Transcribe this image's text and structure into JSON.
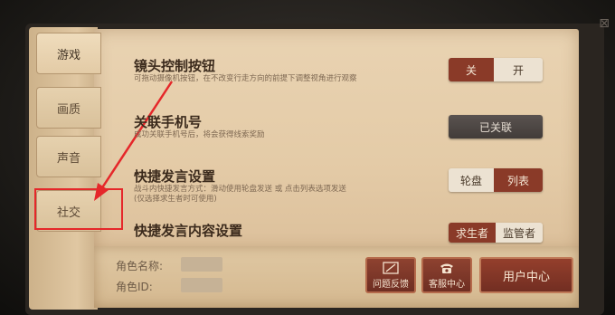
{
  "tabs": [
    {
      "label": "游戏",
      "active": true
    },
    {
      "label": "画质"
    },
    {
      "label": "声音"
    },
    {
      "label": "社交",
      "highlighted": true
    }
  ],
  "settings": {
    "camera": {
      "title": "镜头控制按钮",
      "desc": "可拖动摄像机按钮，在不改变行走方向的前提下调整视角进行观察",
      "toggle": {
        "off_label": "关",
        "on_label": "开",
        "selected": "关"
      }
    },
    "phone": {
      "title": "关联手机号",
      "desc": "成功关联手机号后，将会获得线索奖励",
      "button_label": "已关联"
    },
    "quick_chat": {
      "title": "快捷发言设置",
      "desc_line1": "战斗内快捷发言方式：滑动使用轮盘发送 或 点击列表选项发送",
      "desc_line2": "(仅选择求生者时可使用)",
      "toggle": {
        "a": "轮盘",
        "b": "列表",
        "selected": "列表"
      }
    },
    "quick_chat_content": {
      "title": "快捷发言内容设置",
      "toggle": {
        "a": "求生者",
        "b": "监管者",
        "selected": "求生者"
      }
    }
  },
  "info": {
    "role_name_label": "角色名称:",
    "role_id_label": "角色ID:"
  },
  "actions": {
    "feedback": "问题反馈",
    "support": "客服中心",
    "user_center": "用户中心"
  },
  "colors": {
    "accent_red": "#8a3a28",
    "highlight": "#e5272a"
  }
}
